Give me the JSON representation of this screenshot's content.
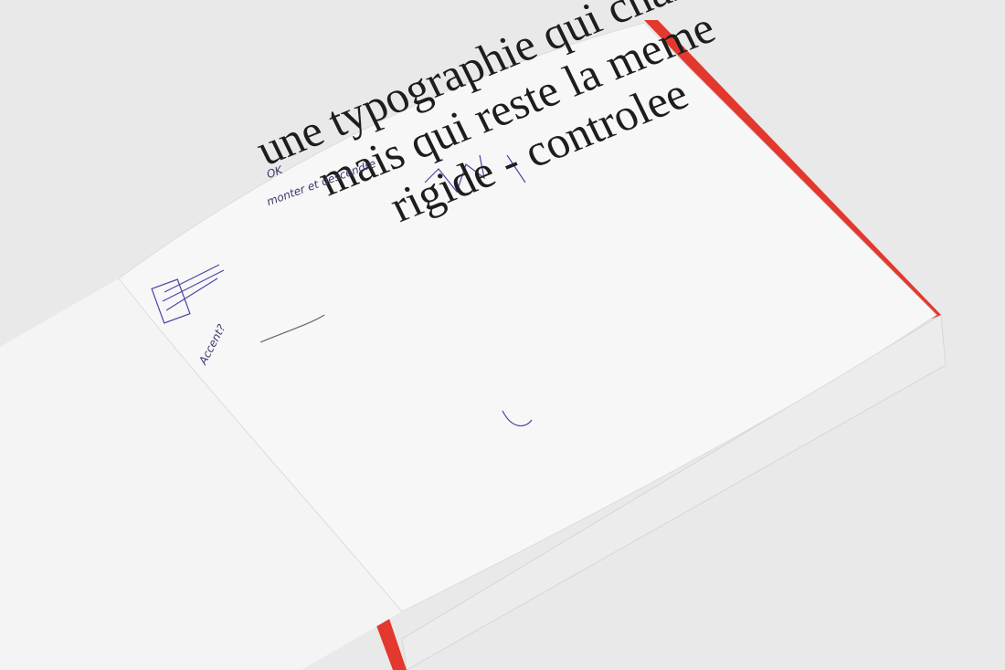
{
  "page_text": {
    "line1": "une typographie qui change",
    "line2": "mais qui reste la meme",
    "line3": "rigide - controlee"
  },
  "handwritten_notes": {
    "ok": "OK",
    "monter": "monter et descendre",
    "accent": "Accent?"
  },
  "colors": {
    "background": "#e9e9e9",
    "page": "#f7f7f8",
    "edge_red": "#e3382d",
    "ink": "#1d1d1d",
    "pen": "#4a46a8"
  }
}
